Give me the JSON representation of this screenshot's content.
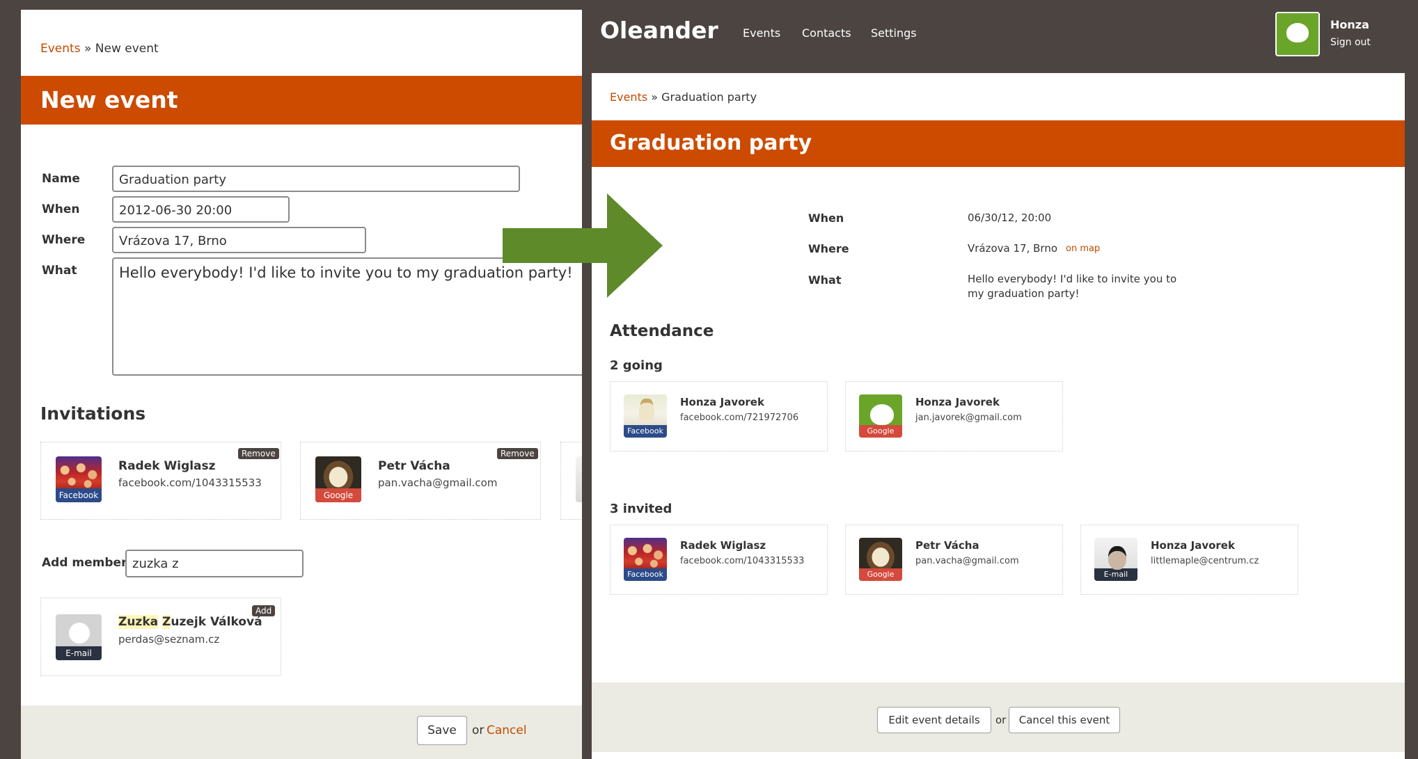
{
  "left": {
    "breadcrumb": {
      "link": "Events",
      "separator": " » ",
      "current": "New event"
    },
    "title": "New event",
    "form": {
      "name_label": "Name",
      "name_value": "Graduation party",
      "when_label": "When",
      "when_value": "2012-06-30 20:00",
      "where_label": "Where",
      "where_value": "Vrázova 17, Brno",
      "what_label": "What",
      "what_value": "Hello everybody! I'd like to invite you to my graduation party!"
    },
    "invitations": {
      "heading": "Invitations",
      "cards": [
        {
          "name": "Radek Wiglasz",
          "sub": "facebook.com/1043315533",
          "source": "Facebook",
          "action": "Remove"
        },
        {
          "name": "Petr Vácha",
          "sub": "pan.vacha@gmail.com",
          "source": "Google",
          "action": "Remove"
        }
      ]
    },
    "add_member": {
      "label": "Add member",
      "value": "zuzka z"
    },
    "suggestion": {
      "name_hl1": "Zuzka",
      "name_mid": " ",
      "name_hl2": "Z",
      "name_rest": "uzejk Válková",
      "sub": "perdas@seznam.cz",
      "source": "E-mail",
      "action": "Add"
    },
    "footer": {
      "save": "Save",
      "or": "or",
      "cancel": "Cancel"
    }
  },
  "right": {
    "header": {
      "logo": "Oleander",
      "nav": [
        "Events",
        "Contacts",
        "Settings"
      ],
      "user": "Honza",
      "sign_out": "Sign out"
    },
    "breadcrumb": {
      "link": "Events",
      "separator": " » ",
      "current": "Graduation party"
    },
    "title": "Graduation party",
    "details": {
      "when_label": "When",
      "when_value": "06/30/12, 20:00",
      "where_label": "Where",
      "where_value": "Vrázova 17, Brno",
      "map_link": "on map",
      "what_label": "What",
      "what_line1": "Hello everybody! I'd like to invite you to",
      "what_line2": "my graduation party!"
    },
    "attendance": {
      "heading": "Attendance",
      "going_label": "2 going",
      "going": [
        {
          "name": "Honza Javorek",
          "sub": "facebook.com/721972706",
          "source": "Facebook"
        },
        {
          "name": "Honza Javorek",
          "sub": "jan.javorek@gmail.com",
          "source": "Google"
        }
      ],
      "invited_label": "3 invited",
      "invited": [
        {
          "name": "Radek Wiglasz",
          "sub": "facebook.com/1043315533",
          "source": "Facebook"
        },
        {
          "name": "Petr Vácha",
          "sub": "pan.vacha@gmail.com",
          "source": "Google"
        },
        {
          "name": "Honza Javorek",
          "sub": "littlemaple@centrum.cz",
          "source": "E-mail"
        }
      ]
    },
    "footer": {
      "edit": "Edit event details",
      "or": "or",
      "cancel": "Cancel this event"
    }
  },
  "colors": {
    "brand_orange": "#cc4b00",
    "frame_brown": "#4b4440",
    "arrow_green": "#5e8a2a",
    "footer_beige": "#ecebe3"
  },
  "icons": [
    "arrow-right-icon",
    "user-avatar-icon"
  ]
}
